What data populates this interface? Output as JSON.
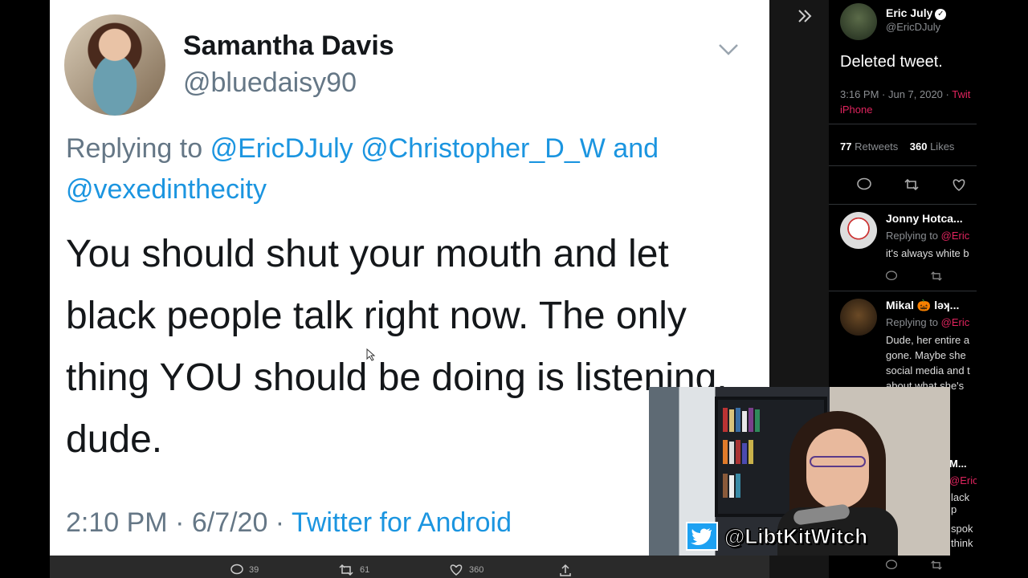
{
  "tweet": {
    "display_name": "Samantha Davis",
    "handle": "@bluedaisy90",
    "replying_prefix": "Replying to",
    "mention_1": "@EricDJuly",
    "mention_2": "@Christopher_D_W",
    "replying_and": "and",
    "mention_3": "@vexedinthecity",
    "text": "You should shut your mouth and let black people talk right now. The only thing YOU should be doing is listening, dude.",
    "time": "2:10 PM · 6/7/20 ·",
    "source": "Twitter for Android"
  },
  "bottom_actions": {
    "replies": "39",
    "retweets": "61",
    "likes": "360"
  },
  "side_panel": {
    "name": "Eric July",
    "handle": "@EricDJuly",
    "deleted": "Deleted tweet.",
    "time": "3:16 PM · Jun 7, 2020 ·",
    "via_partial": "Twit",
    "device": "iPhone",
    "retweets_count": "77",
    "retweets_label": "Retweets",
    "likes_count": "360",
    "likes_label": "Likes",
    "replies": [
      {
        "name": "Jonny Hotca...",
        "replying": "Replying to",
        "mention": "@Eric",
        "body": "it's always white b"
      },
      {
        "name": "Mikal 🎃 ləʞ...",
        "replying": "Replying to",
        "mention": "@Eric",
        "body": "Dude, her entire a gone. Maybe she social media and t about what she's"
      }
    ],
    "partial_fragments": {
      "name_tail": "M...",
      "mention": "@Eric",
      "body_1": "lack p",
      "body_2": "spok",
      "body_3": "think"
    }
  },
  "webcam": {
    "handle": "@LibtKitWitch"
  },
  "colors": {
    "accent": "#1b95e0",
    "pink": "#e0245e",
    "muted": "#657786"
  }
}
